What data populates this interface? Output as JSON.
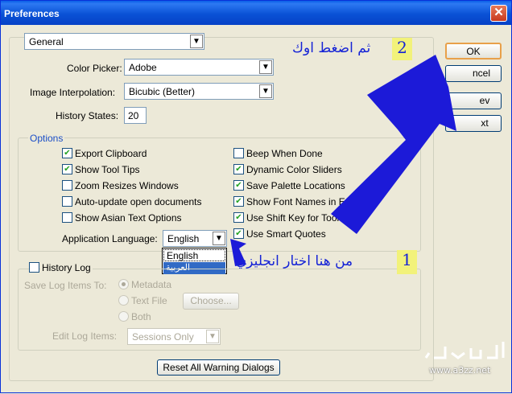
{
  "window": {
    "title": "Preferences",
    "close_glyph": "✕"
  },
  "general_select": {
    "value": "General"
  },
  "color_picker": {
    "label": "Color Picker:",
    "value": "Adobe"
  },
  "interpolation": {
    "label": "Image Interpolation:",
    "value": "Bicubic (Better)"
  },
  "history_states": {
    "label": "History States:",
    "value": "20"
  },
  "options": {
    "legend": "Options",
    "left": [
      {
        "label": "Export Clipboard",
        "checked": true
      },
      {
        "label": "Show Tool Tips",
        "checked": true
      },
      {
        "label": "Zoom Resizes Windows",
        "checked": false
      },
      {
        "label": "Auto-update open documents",
        "checked": false
      },
      {
        "label": "Show Asian Text Options",
        "checked": false
      }
    ],
    "right": [
      {
        "label": "Beep When Done",
        "checked": false
      },
      {
        "label": "Dynamic Color Sliders",
        "checked": true
      },
      {
        "label": "Save Palette Locations",
        "checked": true
      },
      {
        "label": "Show Font Names in Engli",
        "checked": true
      },
      {
        "label": "Use Shift Key for Tool S",
        "checked": true
      },
      {
        "label": "Use Smart Quotes",
        "checked": true
      }
    ],
    "app_language_label": "Application Language:",
    "app_language_value": "English",
    "language_options": [
      "English",
      "العربية"
    ]
  },
  "history_log": {
    "label": "History Log",
    "save_items_label": "Save Log Items To:",
    "radio_metadata": "Metadata",
    "radio_textfile": "Text File",
    "radio_both": "Both",
    "choose_button": "Choose...",
    "edit_items_label": "Edit Log Items:",
    "edit_items_value": "Sessions Only"
  },
  "reset_button": "Reset All Warning Dialogs",
  "buttons": {
    "ok": "OK",
    "cancel": "ncel",
    "prev": "ev",
    "next": "xt"
  },
  "annotations": {
    "step1_num": "1",
    "step1_text": "من هنا اختار انجليزي",
    "step2_num": "2",
    "step2_text": "ثم اضغط اوك"
  },
  "watermark": {
    "text": "www.a3zz.net"
  },
  "colors": {
    "arrow": "#1c1ad8",
    "annotation_text": "#1523d6",
    "badge": "#f2f27a"
  }
}
